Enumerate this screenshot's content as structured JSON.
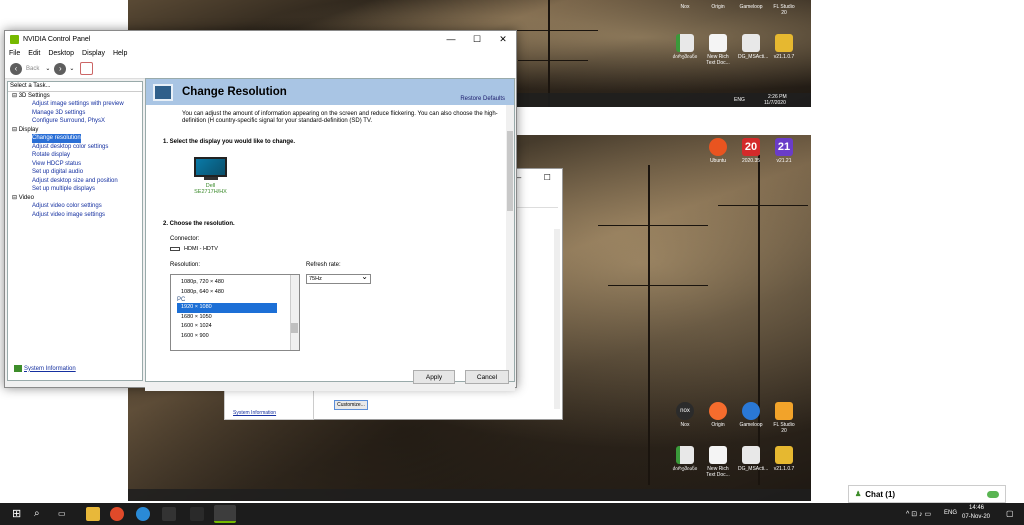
{
  "window": {
    "title": "NVIDIA Control Panel",
    "menu": [
      "File",
      "Edit",
      "Desktop",
      "Display",
      "Help"
    ],
    "back_label": "Back"
  },
  "tasks": {
    "heading": "Select a Task...",
    "groups": [
      {
        "label": "3D Settings",
        "items": [
          "Adjust image settings with preview",
          "Manage 3D settings",
          "Configure Surround, PhysX"
        ]
      },
      {
        "label": "Display",
        "items": [
          "Change resolution",
          "Adjust desktop color settings",
          "Rotate display",
          "View HDCP status",
          "Set up digital audio",
          "Adjust desktop size and position",
          "Set up multiple displays"
        ]
      },
      {
        "label": "Video",
        "items": [
          "Adjust video color settings",
          "Adjust video image settings"
        ]
      }
    ],
    "selected": "Change resolution",
    "system_information": "System Information"
  },
  "content": {
    "title": "Change Resolution",
    "restore_defaults": "Restore Defaults",
    "description": "You can adjust the amount of information appearing on the screen and reduce flickering. You can also choose the high-definition (H country-specific signal for your standard-definition (SD) TV.",
    "step1": "1. Select the display you would like to change.",
    "display_name": "Dell SE2717H/HX",
    "step2": "2. Choose the resolution.",
    "connector_label": "Connector:",
    "connector_value": "HDMI - HDTV",
    "resolution_label": "Resolution:",
    "resolutions": [
      "1080p, 720 × 480",
      "1080p, 640 × 480"
    ],
    "group_pc": "PC",
    "pc_resolutions": [
      "1920 × 1080",
      "1680 × 1050",
      "1600 × 1024",
      "1600 × 900"
    ],
    "selected_resolution": "1920 × 1080",
    "refresh_label": "Refresh rate:",
    "refresh_value": "75Hz"
  },
  "buttons": {
    "apply": "Apply",
    "cancel": "Cancel"
  },
  "background_window": {
    "customize": "Customize...",
    "system_information": "System Information"
  },
  "desktop": {
    "top_icons": [
      "Nox",
      "Origin",
      "Gameloop",
      "FL Studio 20"
    ],
    "row2_icons": [
      "ძირეშიანი",
      "New Rich Text Doc...",
      "DG_MSActi...",
      "v21.1.0.7"
    ],
    "mid_icons": [
      "Ubuntu",
      "2020.35",
      "v21.21"
    ],
    "bottom_icons": [
      "Nox",
      "Origin",
      "Gameloop",
      "FL Studio 20"
    ],
    "bottom_row2": [
      "ძირეშიანი",
      "New Rich Text Doc...",
      "DG_MSActi...",
      "v21.1.0.7"
    ],
    "mini_time": "2:26 PM",
    "mini_date": "11/7/2020",
    "mini_lang": "ENG"
  },
  "chat": {
    "label": "Chat (1)"
  },
  "taskbar": {
    "lang": "ENG",
    "time": "14:46",
    "date": "07-Nov-20"
  },
  "colors": {
    "nvidia_green": "#76b900",
    "selection_blue": "#2a6fd6",
    "banner": "#a9c5e4"
  }
}
